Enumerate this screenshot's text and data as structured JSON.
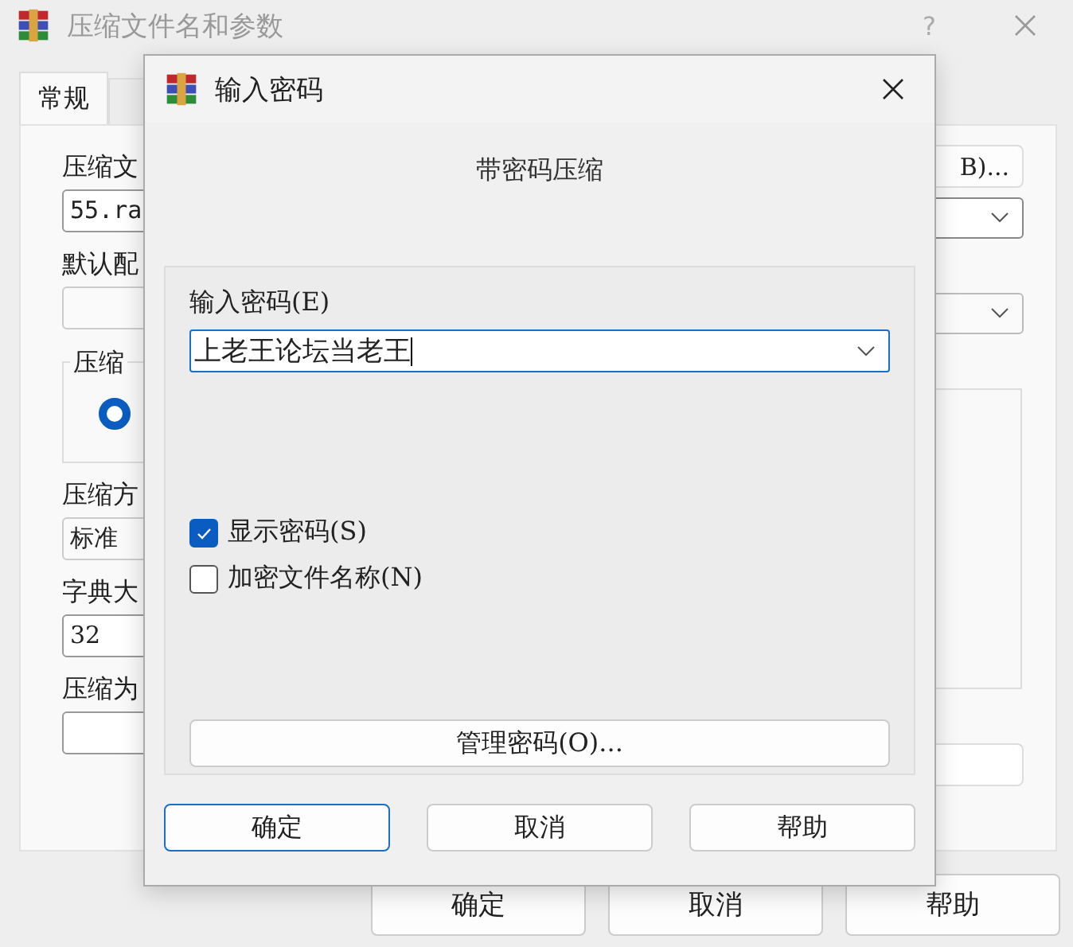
{
  "window": {
    "title": "压缩文件名和参数",
    "help": "?"
  },
  "tabs": [
    {
      "label": "常规",
      "selected": true
    },
    {
      "selected": false
    }
  ],
  "general": {
    "archive_label": "压缩文",
    "archive_name": "55.ra",
    "browse_button": "B)...",
    "profile_label": "默认配",
    "format_group": "压缩",
    "format_radio_selected": true,
    "method_label": "压缩方",
    "method_value": "标准",
    "dict_label": "字典大",
    "dict_value": "32",
    "split_label": "压缩为"
  },
  "buttons": [
    "确定",
    "取消",
    "帮助"
  ],
  "dialog": {
    "title": "输入密码",
    "heading": "带密码压缩",
    "password_label": "输入密码(E)",
    "password": "上老王论坛当老王",
    "options": [
      {
        "label": "显示密码(S)",
        "checked": true
      },
      {
        "label": "加密文件名称(N)",
        "checked": false
      }
    ],
    "manage_button": "管理密码(O)...",
    "buttons": [
      {
        "label": "确定",
        "default": true
      },
      {
        "label": "取消",
        "default": false
      },
      {
        "label": "帮助",
        "default": false
      }
    ]
  }
}
